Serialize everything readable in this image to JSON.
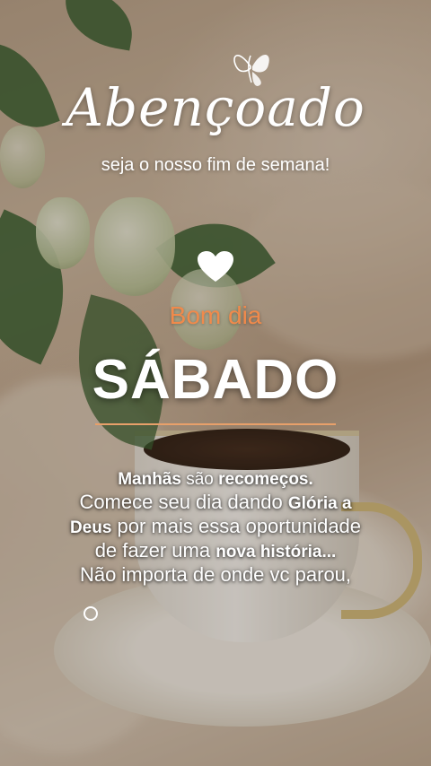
{
  "header": {
    "title": "Abençoado",
    "subtitle": "seja o nosso fim de semana!"
  },
  "greeting": {
    "salutation": "Bom dia",
    "day": "SÁBADO"
  },
  "message": {
    "l1_b1": "Manhãs",
    "l1_t1": " são ",
    "l1_b2": "recomeços.",
    "l2_t1": "Comece seu dia dando ",
    "l2_b1": "Glória a",
    "l3_b1": "Deus",
    "l3_t1": " por mais essa oportunidade",
    "l4_t1": "de fazer uma ",
    "l4_b1": "nova história...",
    "l5_t1": "Não importa de onde vc parou,"
  },
  "icons": [
    "butterfly-icon",
    "heart-icon",
    "circle-bullet-icon"
  ],
  "colors": {
    "accent": "#f08a4b",
    "text": "#ffffff",
    "rule": "#e8a06a"
  }
}
